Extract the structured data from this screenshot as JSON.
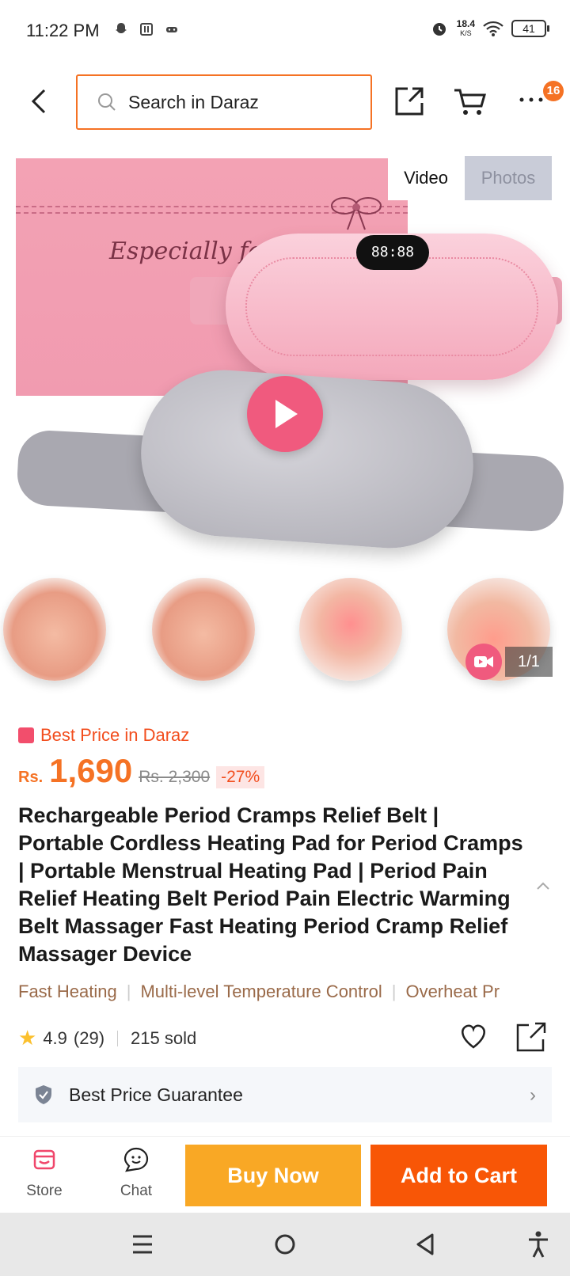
{
  "status_bar": {
    "time": "11:22 PM",
    "net_speed": "18.4",
    "net_unit": "K/S",
    "battery": "41"
  },
  "header": {
    "search_placeholder": "Search in Daraz",
    "cart_badge": "16"
  },
  "gallery": {
    "tab_video": "Video",
    "tab_photos": "Photos",
    "counter": "1/1",
    "box_text": "Especially for"
  },
  "price": {
    "best_price_label": "Best Price in Daraz",
    "currency": "Rs.",
    "current": "1,690",
    "original": "Rs. 2,300",
    "discount": "-27%"
  },
  "product": {
    "title": "Rechargeable Period Cramps Relief Belt | Portable Cordless Heating Pad for Period Cramps | Portable Menstrual Heating Pad | Period Pain Relief Heating Belt Period Pain Electric Warming Belt Massager Fast Heating Period Cramp Relief Massager Device",
    "features": [
      "Fast Heating",
      "Multi-level Temperature Control",
      "Overheat Pr"
    ],
    "rating": "4.9",
    "rating_count": "(29)",
    "sold": "215 sold",
    "guarantee": "Best Price Guarantee"
  },
  "actions": {
    "store": "Store",
    "chat": "Chat",
    "buy_now": "Buy Now",
    "add_to_cart": "Add to Cart"
  },
  "colors": {
    "accent": "#f57224",
    "buy_now": "#f9a825",
    "add_to_cart": "#f85606",
    "discount": "#f24e1e"
  }
}
